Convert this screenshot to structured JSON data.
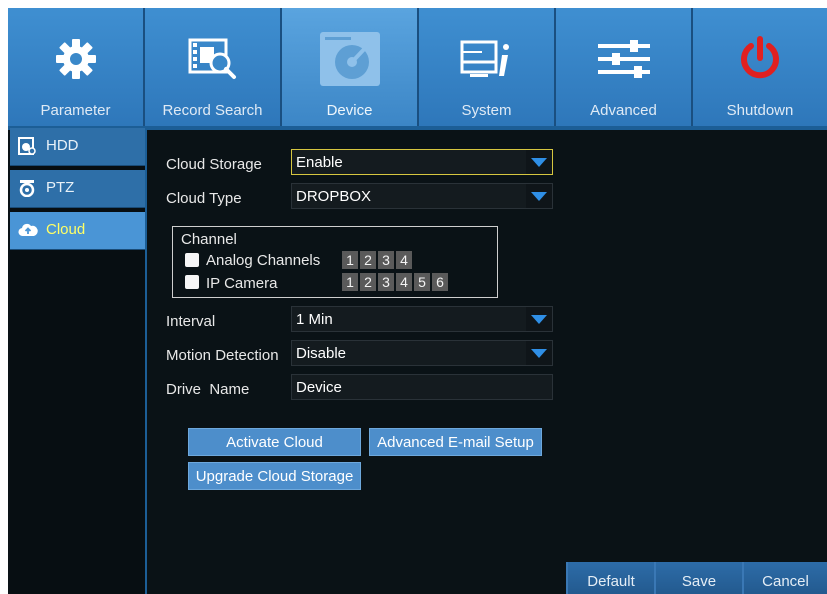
{
  "tabs": [
    {
      "label": "Parameter",
      "icon": "gear-icon"
    },
    {
      "label": "Record Search",
      "icon": "film-search-icon"
    },
    {
      "label": "Device",
      "icon": "hard-disk-icon"
    },
    {
      "label": "System",
      "icon": "monitor-info-icon"
    },
    {
      "label": "Advanced",
      "icon": "sliders-icon"
    },
    {
      "label": "Shutdown",
      "icon": "power-icon"
    }
  ],
  "active_tab": "Device",
  "sidebar": {
    "items": [
      {
        "label": "HDD",
        "icon": "hdd-icon"
      },
      {
        "label": "PTZ",
        "icon": "ptz-camera-icon"
      },
      {
        "label": "Cloud",
        "icon": "cloud-icon"
      }
    ],
    "active": "Cloud"
  },
  "form": {
    "cloud_storage": {
      "label": "Cloud Storage",
      "value": "Enable"
    },
    "cloud_type": {
      "label": "Cloud Type",
      "value": "DROPBOX"
    },
    "channel": {
      "title": "Channel",
      "analog_label": "Analog Channels",
      "analog_channels": [
        "1",
        "2",
        "3",
        "4"
      ],
      "ip_label": "IP Camera",
      "ip_channels": [
        "1",
        "2",
        "3",
        "4",
        "5",
        "6"
      ]
    },
    "interval": {
      "label": "Interval",
      "value": "1 Min"
    },
    "motion_detection": {
      "label": "Motion Detection",
      "value": "Disable"
    },
    "drive_name": {
      "label": "Drive  Name",
      "value": "Device"
    }
  },
  "buttons": {
    "activate_cloud": "Activate Cloud",
    "advanced_email": "Advanced E-mail Setup",
    "upgrade_storage": "Upgrade Cloud Storage"
  },
  "footer": {
    "default": "Default",
    "save": "Save",
    "cancel": "Cancel"
  },
  "colors": {
    "accent": "#3f8fd1",
    "focus_border": "#d6c640",
    "active_sidebar_text": "#ffff66",
    "power_red": "#e02020"
  }
}
